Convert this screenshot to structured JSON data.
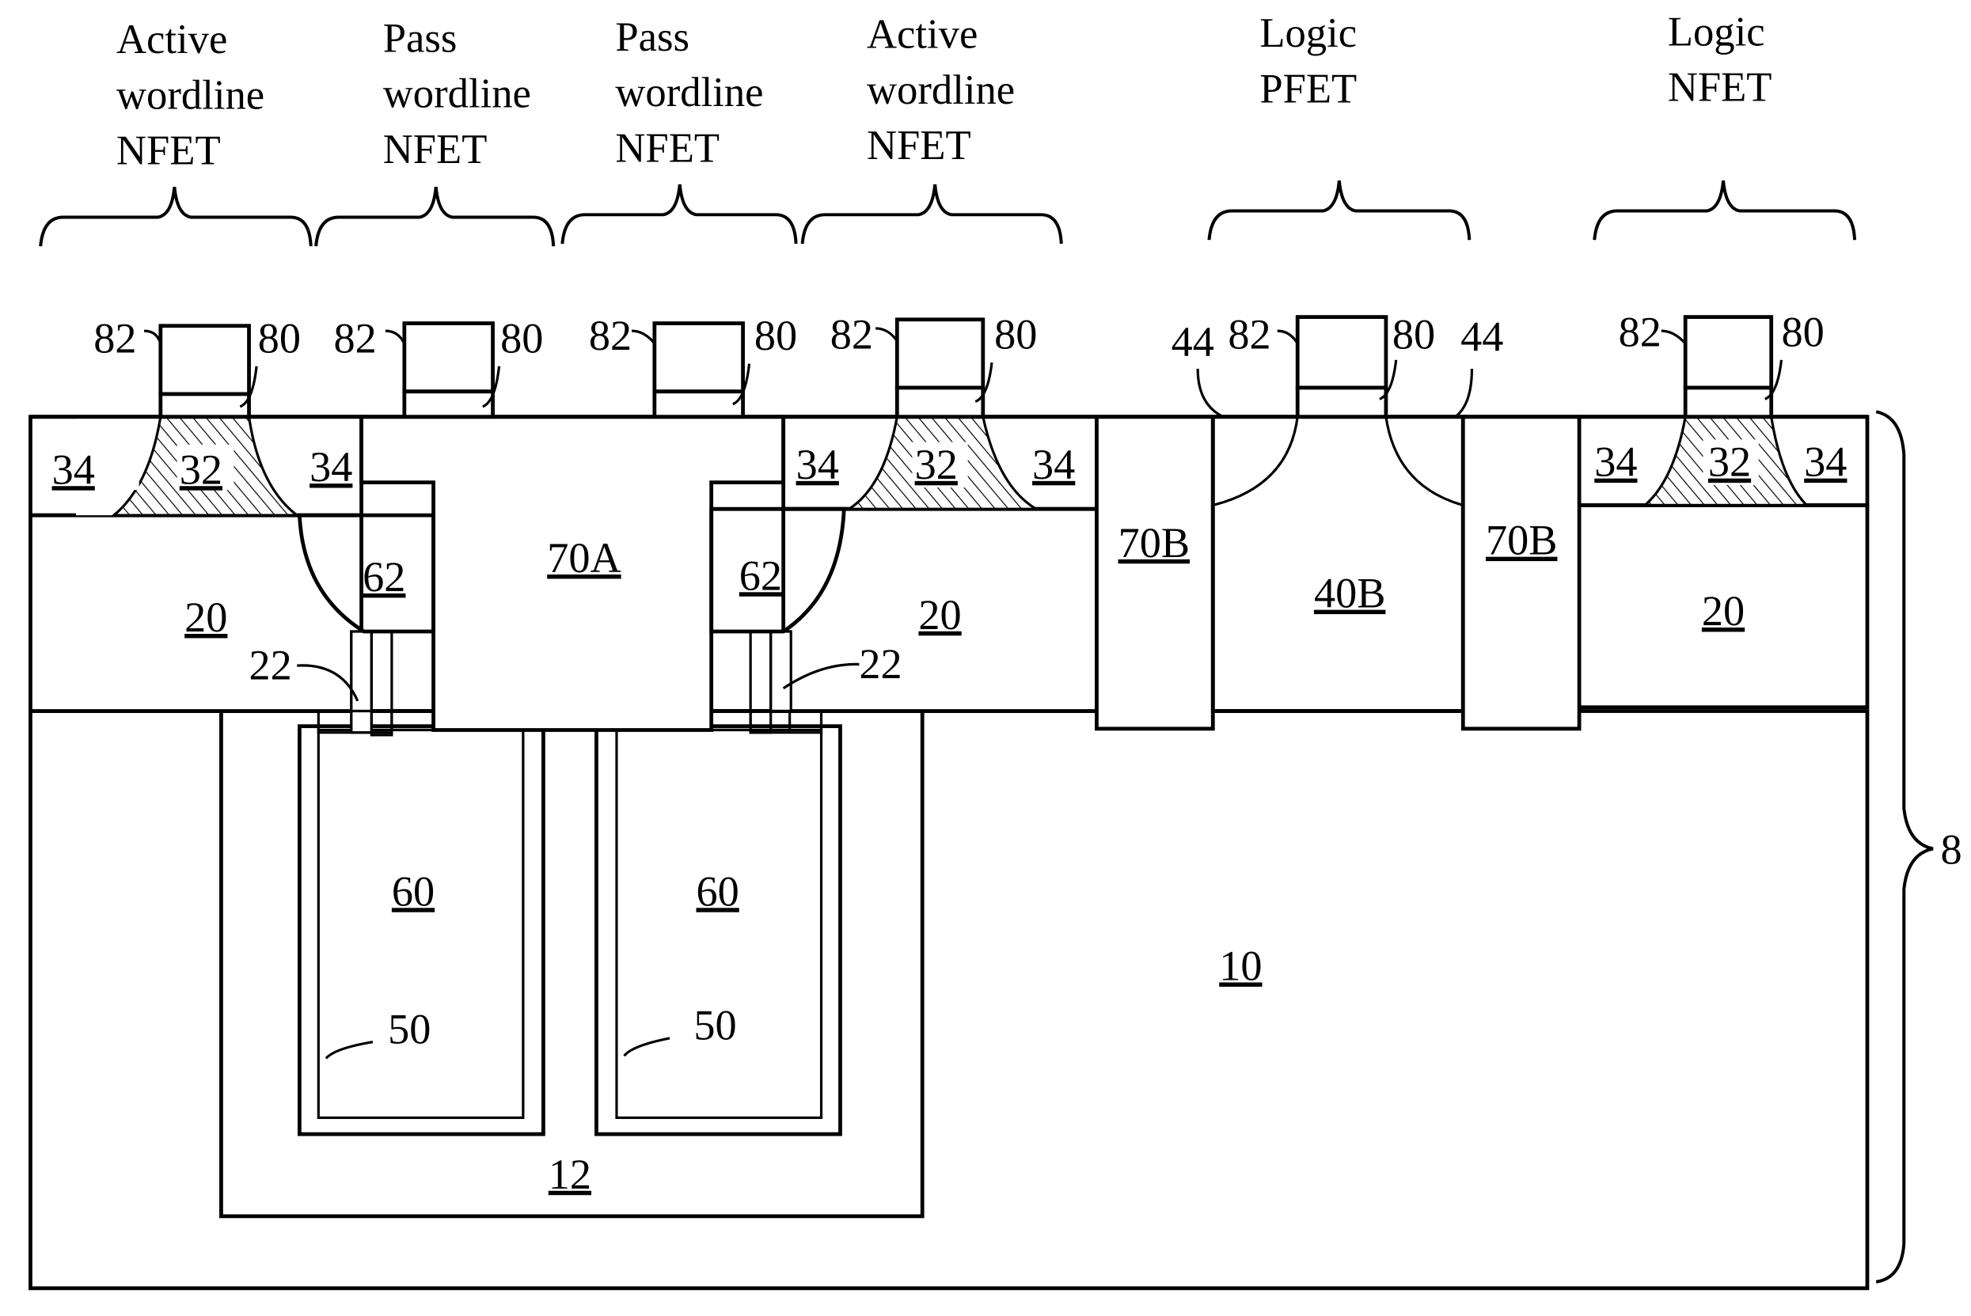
{
  "figure": {
    "type": "semiconductor cross-section",
    "colors": {
      "ink": "#000000",
      "paper": "#ffffff"
    }
  },
  "regions": [
    {
      "name": "active-wordline-nfet-left",
      "lines": [
        "Active",
        "wordline",
        "NFET"
      ]
    },
    {
      "name": "pass-wordline-nfet-left",
      "lines": [
        "Pass",
        "wordline",
        "NFET"
      ]
    },
    {
      "name": "pass-wordline-nfet-right",
      "lines": [
        "Pass",
        "wordline",
        "NFET"
      ]
    },
    {
      "name": "active-wordline-nfet-right",
      "lines": [
        "Active",
        "wordline",
        "NFET"
      ]
    },
    {
      "name": "logic-pfet",
      "lines": [
        "Logic",
        "PFET"
      ]
    },
    {
      "name": "logic-nfet",
      "lines": [
        "Logic",
        "NFET"
      ]
    }
  ],
  "gate_labels": {
    "cap": "82",
    "gate": "80",
    "pfet_extension": "44"
  },
  "labels": {
    "sd_extension": "34",
    "channel": "32",
    "strap": "62",
    "sti_array": "70A",
    "sti_logic": "70B",
    "nwell": "40B",
    "soi_layer": "20",
    "collar": "22",
    "node_dielectric": "50",
    "trench_fill": "60",
    "buried_plate": "12",
    "substrate": "10",
    "wafer": "8"
  }
}
